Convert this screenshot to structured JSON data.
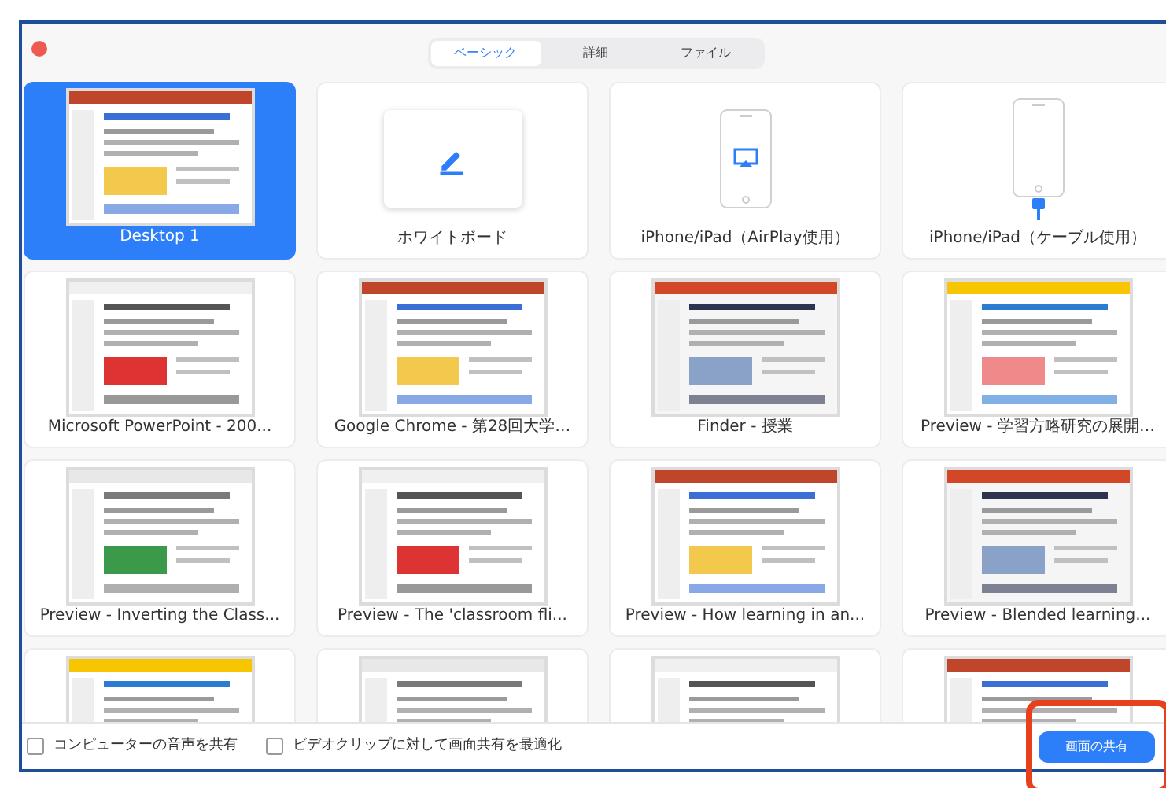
{
  "tabs": [
    {
      "label": "ベーシック",
      "selected": true
    },
    {
      "label": "詳細",
      "selected": false
    },
    {
      "label": "ファイル",
      "selected": false
    }
  ],
  "sources": [
    {
      "kind": "desktop",
      "title": "Desktop 1",
      "selected": true
    },
    {
      "kind": "whiteboard",
      "title": "ホワイトボード",
      "selected": false
    },
    {
      "kind": "airplay",
      "title": "iPhone/iPad（AirPlay使用）",
      "selected": false
    },
    {
      "kind": "cable",
      "title": "iPhone/iPad（ケーブル使用）",
      "selected": false
    },
    {
      "kind": "window",
      "title": "Microsoft PowerPoint - 200...",
      "selected": false
    },
    {
      "kind": "window",
      "title": "Google Chrome - 第28回大学…",
      "selected": false
    },
    {
      "kind": "window",
      "title": "Finder - 授業",
      "selected": false
    },
    {
      "kind": "window",
      "title": "Preview - 学習方略研究の展開…",
      "selected": false
    },
    {
      "kind": "window",
      "title": "Preview - Inverting the Class...",
      "selected": false
    },
    {
      "kind": "window",
      "title": "Preview - The 'classroom fli...",
      "selected": false
    },
    {
      "kind": "window",
      "title": "Preview - How learning in an...",
      "selected": false
    },
    {
      "kind": "window",
      "title": "Preview - Blended learning...",
      "selected": false
    },
    {
      "kind": "window",
      "selected": false
    },
    {
      "kind": "window",
      "selected": false
    },
    {
      "kind": "window",
      "selected": false
    },
    {
      "kind": "window",
      "selected": false
    }
  ],
  "options": [
    {
      "label": "コンピューターの音声を共有",
      "checked": false
    },
    {
      "label": "ビデオクリップに対して画面共有を最適化",
      "checked": false
    }
  ],
  "share_button": {
    "label": "画面の共有",
    "highlighted": true
  }
}
